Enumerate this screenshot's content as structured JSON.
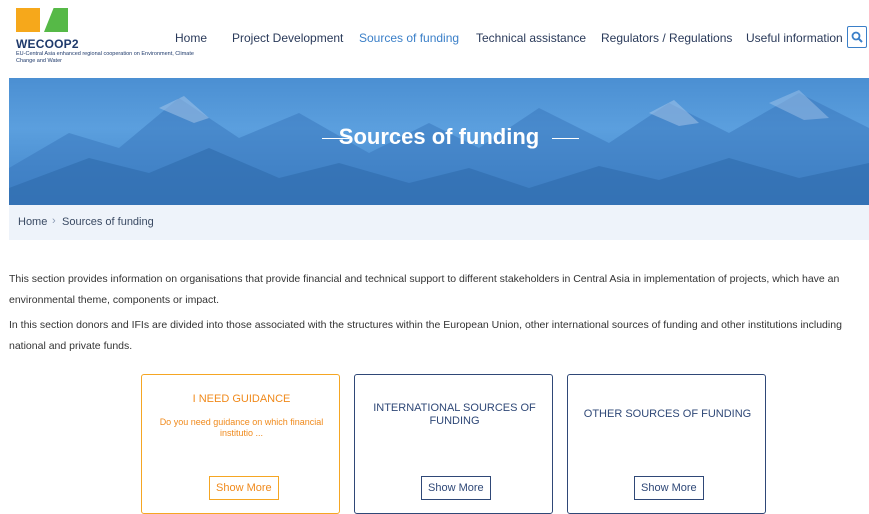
{
  "logo": {
    "title": "WECOOP2",
    "subtitle": "EU-Central Asia enhanced regional cooperation on Environment, Climate Change and Water",
    "colors": {
      "orange": "#f6a81b",
      "green": "#56b947"
    }
  },
  "nav": {
    "items": [
      {
        "label": "Home",
        "active": false
      },
      {
        "label": "Project Development",
        "active": false
      },
      {
        "label": "Sources of funding",
        "active": true
      },
      {
        "label": "Technical assistance",
        "active": false
      },
      {
        "label": "Regulators / Regulations",
        "active": false
      },
      {
        "label": "Useful information",
        "active": false
      }
    ],
    "search_icon": "search-icon",
    "active_color": "#3a7fc8"
  },
  "banner": {
    "title": "Sources of funding",
    "bg_color": "#4b8fd2"
  },
  "breadcrumb": {
    "home": "Home",
    "separator": "›",
    "current": "Sources of funding"
  },
  "intro": {
    "p1": "This section provides information on organisations that provide financial and technical support to different stakeholders in Central Asia in implementation of projects, which have an environmental theme, components or impact.",
    "p2": "In this section donors and IFIs are divided into those associated with the structures within the European Union, other international sources of funding and other institutions including national and private funds."
  },
  "cards": [
    {
      "title": "I NEED GUIDANCE",
      "description": "Do you need guidance on which financial institutio ...",
      "button": "Show More",
      "accent": "#f5a623"
    },
    {
      "title": "INTERNATIONAL SOURCES OF FUNDING",
      "description": "",
      "button": "Show More",
      "accent": "#2f4877"
    },
    {
      "title": "OTHER SOURCES OF FUNDING",
      "description": "",
      "button": "Show More",
      "accent": "#2f4877"
    }
  ]
}
